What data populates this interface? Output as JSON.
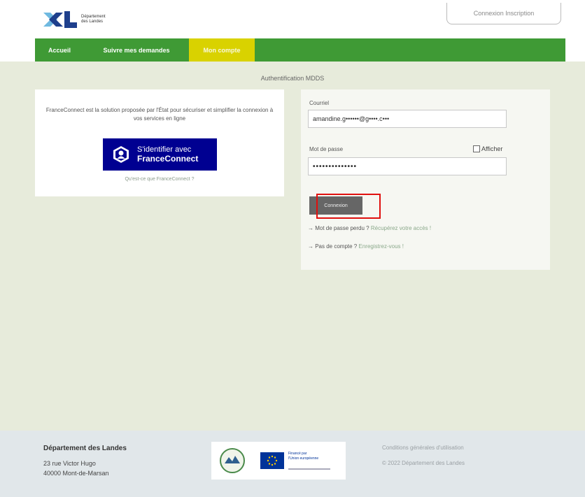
{
  "header": {
    "logo_line1": "Département",
    "logo_line2": "des Landes",
    "auth_links": "Connexion  Inscription"
  },
  "nav": {
    "items": [
      {
        "label": "Accueil"
      },
      {
        "label": "Suivre mes demandes"
      },
      {
        "label": "Mon compte"
      }
    ]
  },
  "page": {
    "title": "Authentification MDDS"
  },
  "franceconnect": {
    "description": "FranceConnect est la solution proposée par l'État pour sécuriser et simplifier la connexion à vos services en ligne",
    "button_line1": "S'identifier avec",
    "button_line2": "FranceConnect",
    "info_link": "Qu'est-ce que FranceConnect ?"
  },
  "login": {
    "email_label": "Courriel",
    "email_value": "amandine.g••••••@g••••.c•••",
    "password_label": "Mot de passe",
    "show_label": "Afficher",
    "password_value": "••••••••••••••",
    "submit_label": "Connexion",
    "forgot_prefix": "→ Mot de passe perdu ?",
    "forgot_link": "Récupérez votre accès !",
    "noaccount_prefix": "→ Pas de compte ?",
    "noaccount_link": "Enregistrez-vous !"
  },
  "footer": {
    "org_name": "Département des Landes",
    "address1": "23 rue Victor Hugo",
    "address2": "40000 Mont-de-Marsan",
    "eu_line1": "Financé par",
    "eu_line2": "l'Union européenne",
    "terms_link": "Conditions générales d'utilisation",
    "copyright": "© 2022 Département des Landes"
  },
  "colors": {
    "nav_green": "#3f9a35",
    "nav_active": "#d9d200",
    "content_bg": "#e7ebdb",
    "fc_blue": "#000091",
    "footer_bg": "#e1e7ea",
    "highlight": "#e0100e"
  }
}
